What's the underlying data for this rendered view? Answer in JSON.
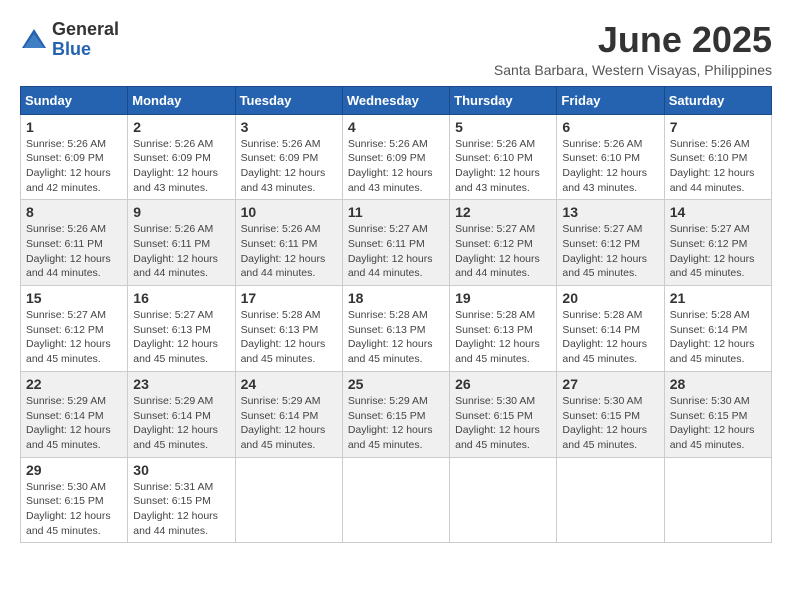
{
  "logo": {
    "general": "General",
    "blue": "Blue"
  },
  "title": {
    "month_year": "June 2025",
    "location": "Santa Barbara, Western Visayas, Philippines"
  },
  "days_of_week": [
    "Sunday",
    "Monday",
    "Tuesday",
    "Wednesday",
    "Thursday",
    "Friday",
    "Saturday"
  ],
  "weeks": [
    [
      {
        "day": "1",
        "sunrise": "5:26 AM",
        "sunset": "6:09 PM",
        "daylight": "12 hours and 42 minutes."
      },
      {
        "day": "2",
        "sunrise": "5:26 AM",
        "sunset": "6:09 PM",
        "daylight": "12 hours and 43 minutes."
      },
      {
        "day": "3",
        "sunrise": "5:26 AM",
        "sunset": "6:09 PM",
        "daylight": "12 hours and 43 minutes."
      },
      {
        "day": "4",
        "sunrise": "5:26 AM",
        "sunset": "6:09 PM",
        "daylight": "12 hours and 43 minutes."
      },
      {
        "day": "5",
        "sunrise": "5:26 AM",
        "sunset": "6:10 PM",
        "daylight": "12 hours and 43 minutes."
      },
      {
        "day": "6",
        "sunrise": "5:26 AM",
        "sunset": "6:10 PM",
        "daylight": "12 hours and 43 minutes."
      },
      {
        "day": "7",
        "sunrise": "5:26 AM",
        "sunset": "6:10 PM",
        "daylight": "12 hours and 44 minutes."
      }
    ],
    [
      {
        "day": "8",
        "sunrise": "5:26 AM",
        "sunset": "6:11 PM",
        "daylight": "12 hours and 44 minutes."
      },
      {
        "day": "9",
        "sunrise": "5:26 AM",
        "sunset": "6:11 PM",
        "daylight": "12 hours and 44 minutes."
      },
      {
        "day": "10",
        "sunrise": "5:26 AM",
        "sunset": "6:11 PM",
        "daylight": "12 hours and 44 minutes."
      },
      {
        "day": "11",
        "sunrise": "5:27 AM",
        "sunset": "6:11 PM",
        "daylight": "12 hours and 44 minutes."
      },
      {
        "day": "12",
        "sunrise": "5:27 AM",
        "sunset": "6:12 PM",
        "daylight": "12 hours and 44 minutes."
      },
      {
        "day": "13",
        "sunrise": "5:27 AM",
        "sunset": "6:12 PM",
        "daylight": "12 hours and 45 minutes."
      },
      {
        "day": "14",
        "sunrise": "5:27 AM",
        "sunset": "6:12 PM",
        "daylight": "12 hours and 45 minutes."
      }
    ],
    [
      {
        "day": "15",
        "sunrise": "5:27 AM",
        "sunset": "6:12 PM",
        "daylight": "12 hours and 45 minutes."
      },
      {
        "day": "16",
        "sunrise": "5:27 AM",
        "sunset": "6:13 PM",
        "daylight": "12 hours and 45 minutes."
      },
      {
        "day": "17",
        "sunrise": "5:28 AM",
        "sunset": "6:13 PM",
        "daylight": "12 hours and 45 minutes."
      },
      {
        "day": "18",
        "sunrise": "5:28 AM",
        "sunset": "6:13 PM",
        "daylight": "12 hours and 45 minutes."
      },
      {
        "day": "19",
        "sunrise": "5:28 AM",
        "sunset": "6:13 PM",
        "daylight": "12 hours and 45 minutes."
      },
      {
        "day": "20",
        "sunrise": "5:28 AM",
        "sunset": "6:14 PM",
        "daylight": "12 hours and 45 minutes."
      },
      {
        "day": "21",
        "sunrise": "5:28 AM",
        "sunset": "6:14 PM",
        "daylight": "12 hours and 45 minutes."
      }
    ],
    [
      {
        "day": "22",
        "sunrise": "5:29 AM",
        "sunset": "6:14 PM",
        "daylight": "12 hours and 45 minutes."
      },
      {
        "day": "23",
        "sunrise": "5:29 AM",
        "sunset": "6:14 PM",
        "daylight": "12 hours and 45 minutes."
      },
      {
        "day": "24",
        "sunrise": "5:29 AM",
        "sunset": "6:14 PM",
        "daylight": "12 hours and 45 minutes."
      },
      {
        "day": "25",
        "sunrise": "5:29 AM",
        "sunset": "6:15 PM",
        "daylight": "12 hours and 45 minutes."
      },
      {
        "day": "26",
        "sunrise": "5:30 AM",
        "sunset": "6:15 PM",
        "daylight": "12 hours and 45 minutes."
      },
      {
        "day": "27",
        "sunrise": "5:30 AM",
        "sunset": "6:15 PM",
        "daylight": "12 hours and 45 minutes."
      },
      {
        "day": "28",
        "sunrise": "5:30 AM",
        "sunset": "6:15 PM",
        "daylight": "12 hours and 45 minutes."
      }
    ],
    [
      {
        "day": "29",
        "sunrise": "5:30 AM",
        "sunset": "6:15 PM",
        "daylight": "12 hours and 45 minutes."
      },
      {
        "day": "30",
        "sunrise": "5:31 AM",
        "sunset": "6:15 PM",
        "daylight": "12 hours and 44 minutes."
      },
      null,
      null,
      null,
      null,
      null
    ]
  ]
}
